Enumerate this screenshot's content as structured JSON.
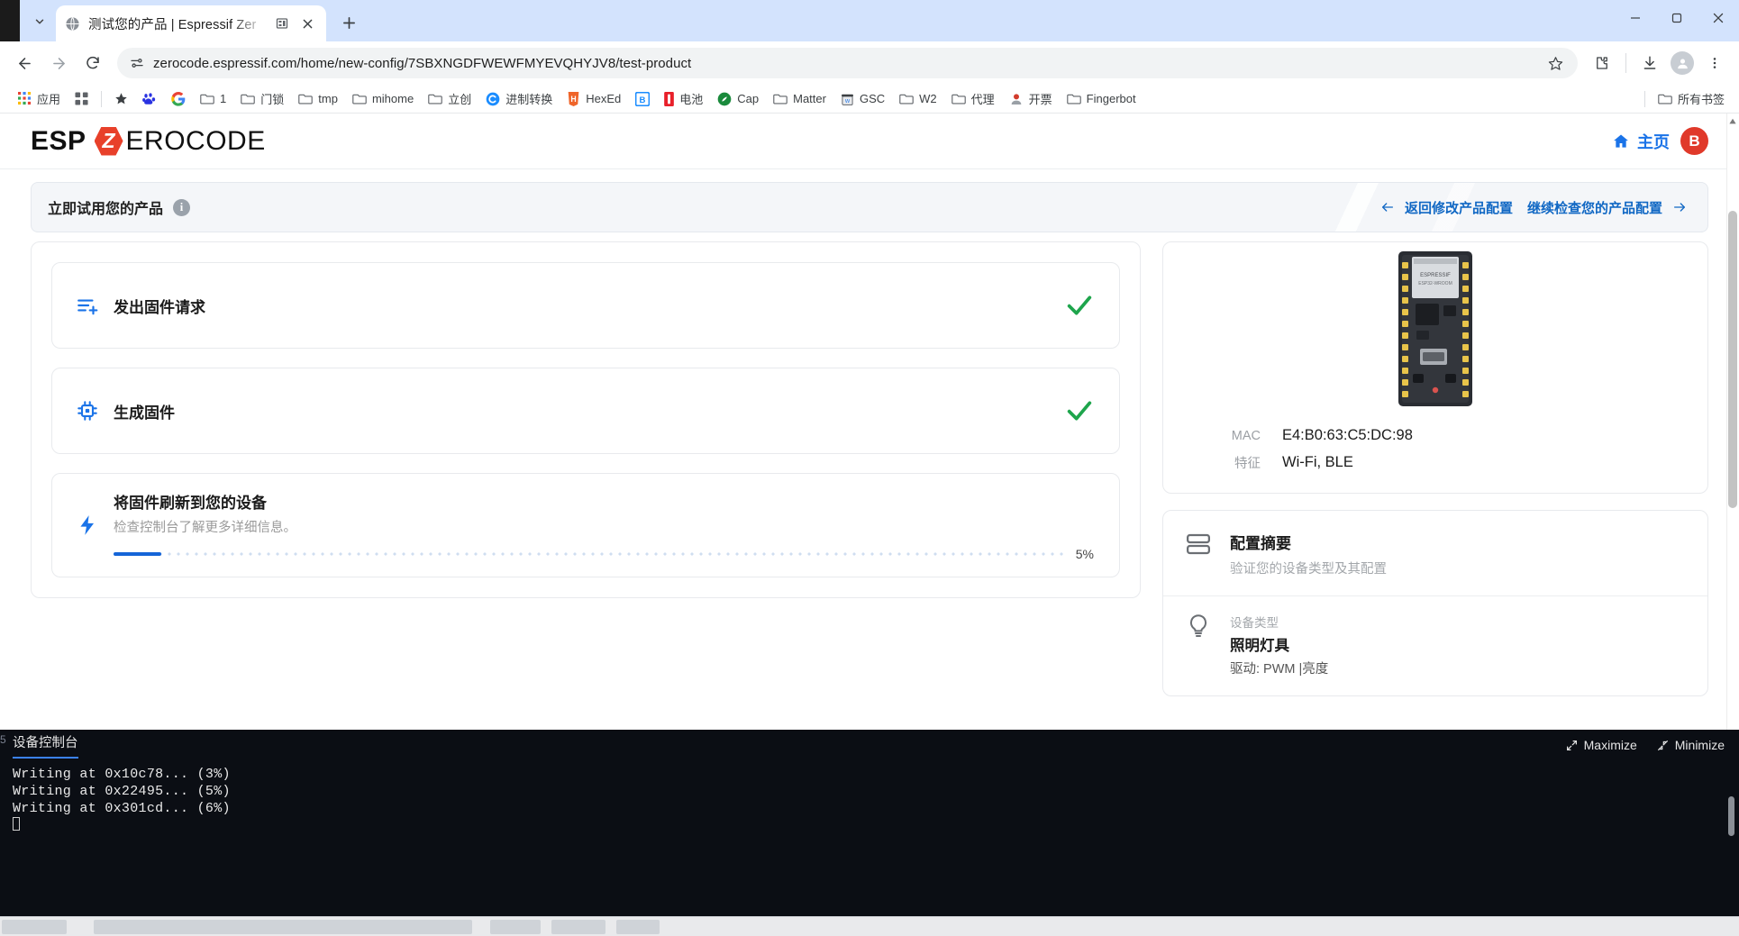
{
  "browser": {
    "tab": {
      "title": "测试您的产品 | Espressif Zer",
      "favicon_name": "globe-icon"
    },
    "new_tab_label": "+",
    "omnibox": {
      "url": "zerocode.espressif.com/home/new-config/7SBXNGDFWEWFMYEVQHYJV8/test-product"
    },
    "bookmarks": [
      {
        "label": "应用",
        "icon": "apps-grid-icon"
      },
      {
        "label": "",
        "icon": "apps-square-icon"
      },
      {
        "label": "",
        "icon": "star-icon"
      },
      {
        "label": "",
        "icon": "baidu-icon"
      },
      {
        "label": "",
        "icon": "google-icon"
      },
      {
        "label": "1",
        "icon": "folder-icon"
      },
      {
        "label": "门锁",
        "icon": "folder-icon"
      },
      {
        "label": "tmp",
        "icon": "folder-icon"
      },
      {
        "label": "mihome",
        "icon": "folder-icon"
      },
      {
        "label": "立创",
        "icon": "folder-icon"
      },
      {
        "label": "进制转换",
        "icon": "c-circle-icon"
      },
      {
        "label": "HexEd",
        "icon": "hexed-icon"
      },
      {
        "label": "",
        "icon": "bitbucket-icon"
      },
      {
        "label": "电池",
        "icon": "battery-red-icon"
      },
      {
        "label": "Cap",
        "icon": "cap-green-icon"
      },
      {
        "label": "Matter",
        "icon": "folder-icon"
      },
      {
        "label": "GSC",
        "icon": "gsc-icon"
      },
      {
        "label": "W2",
        "icon": "folder-icon"
      },
      {
        "label": "代理",
        "icon": "folder-icon"
      },
      {
        "label": "开票",
        "icon": "invoice-icon"
      },
      {
        "label": "Fingerbot",
        "icon": "folder-icon"
      }
    ],
    "all_bookmarks_label": "所有书签"
  },
  "site": {
    "logo": {
      "esp": "ESP",
      "z": "Z",
      "rest": "EROCODE"
    },
    "home_link": "主页",
    "avatar_initial": "B"
  },
  "banner": {
    "title": "立即试用您的产品",
    "info_icon": "i",
    "back_link": "返回修改产品配置",
    "next_link": "继续检查您的产品配置"
  },
  "steps": [
    {
      "icon_name": "request-list-icon",
      "title": "发出固件请求",
      "subtitle": "",
      "status": "done"
    },
    {
      "icon_name": "chip-icon",
      "title": "生成固件",
      "subtitle": "",
      "status": "done"
    },
    {
      "icon_name": "bolt-icon",
      "title": "将固件刷新到您的设备",
      "subtitle": "检查控制台了解更多详细信息。",
      "status": "progress",
      "progress_percent": 5,
      "progress_label": "5%"
    }
  ],
  "device": {
    "board_image_name": "esp32-devkit-board",
    "fields": [
      {
        "key": "MAC",
        "value": "E4:B0:63:C5:DC:98"
      },
      {
        "key": "特征",
        "value": "Wi-Fi, BLE"
      }
    ]
  },
  "config_summary": {
    "icon_name": "list-panel-icon",
    "title": "配置摘要",
    "subtitle": "验证您的设备类型及其配置",
    "items": [
      {
        "icon_name": "bulb-icon",
        "label": "设备类型",
        "title": "照明灯具",
        "sub": "驱动: PWM |亮度"
      }
    ]
  },
  "console": {
    "tab_label": "设备控制台",
    "maximize_label": "Maximize",
    "minimize_label": "Minimize",
    "lines": [
      "Writing at 0x10c78... (3%)",
      "Writing at 0x22495... (5%)",
      "Writing at 0x301cd... (6%)"
    ]
  },
  "colors": {
    "accent_blue": "#1a73e8",
    "brand_red": "#e8402a",
    "success_green": "#1ea54c",
    "progress_blue": "#1565d8"
  }
}
